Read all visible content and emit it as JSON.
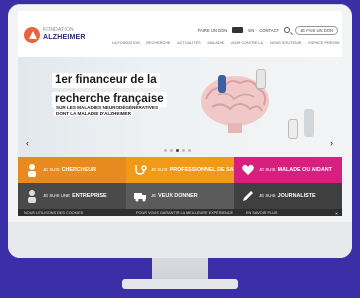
{
  "logo": {
    "line1": "FONDATION",
    "line2": "ALZHEIMER"
  },
  "toplinks": {
    "item1": "FAIRE UN DON",
    "item2": "EN",
    "item3": "CONTACT",
    "donate": "JE FAIS UN DON"
  },
  "nav": [
    "LA FONDATION",
    "RECHERCHE",
    "ACTUALITÉS",
    "MALADIE",
    "AGIR CONTRE LA",
    "NOUS SOUTENIR",
    "ESPACE PRESSE"
  ],
  "hero": {
    "title_line1": "1er financeur de la",
    "title_line2": "recherche française",
    "sub_line1": "SUR LES MALADIES NEURODÉGÉNÉRATIVES",
    "sub_line2": "DONT LA MALADIE D'ALZHEIMER",
    "prev": "‹",
    "next": "›"
  },
  "tiles": [
    {
      "pre": "JE SUIS",
      "main": "CHERCHEUR",
      "color": "#e98a1e"
    },
    {
      "pre": "JE SUIS",
      "main": "PROFESSIONNEL DE SANTÉ",
      "color": "#f29a17"
    },
    {
      "pre": "JE SUIS",
      "main": "MALADE OU AIDANT",
      "color": "#d61f7e"
    },
    {
      "pre": "JE SUIS UNE",
      "main": "ENTREPRISE",
      "color": "#4a4a4a"
    },
    {
      "pre": "JE",
      "main": "VEUX DONNER",
      "color": "#5b5b5b"
    },
    {
      "pre": "JE SUIS",
      "main": "JOURNALISTE",
      "color": "#3f3f3f"
    }
  ],
  "strip": {
    "left": "NOUS UTILISONS DES COOKIES",
    "middle": "POUR VOUS GARANTIR LA MEILLEURE EXPÉRIENCE",
    "right": "EN SAVOIR PLUS",
    "close": "✕"
  }
}
